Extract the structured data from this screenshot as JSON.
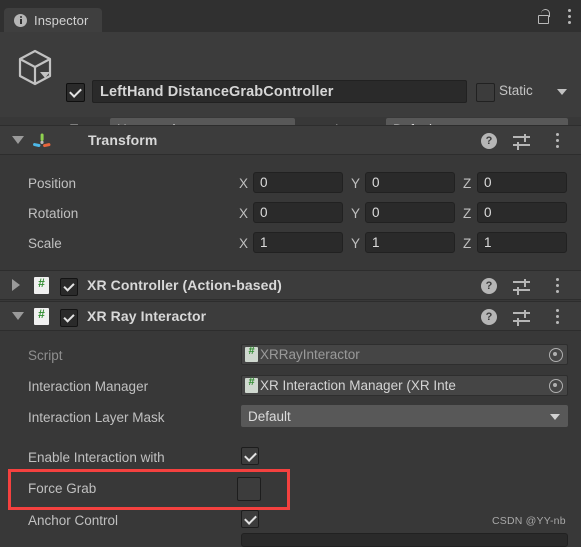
{
  "window": {
    "tab_label": "Inspector",
    "tab_icon": "info-icon",
    "lock_icon": "unlocked-padlock-icon",
    "menu_icon": "kebab-menu-icon"
  },
  "object_header": {
    "icon": "cube-gameobject-icon",
    "enabled": true,
    "name_value": "LeftHand DistanceGrabController",
    "static_label": "Static",
    "static_checked": false,
    "tag_label": "Tag",
    "tag_value": "Untagged",
    "layer_label": "Layer",
    "layer_value": "Default"
  },
  "components": [
    {
      "id": "transform",
      "title": "Transform",
      "icon": "transform-gizmo-icon",
      "expanded": true,
      "has_enable_checkbox": false,
      "rows": [
        {
          "label": "Position",
          "x": "0",
          "y": "0",
          "z": "0"
        },
        {
          "label": "Rotation",
          "x": "0",
          "y": "0",
          "z": "0"
        },
        {
          "label": "Scale",
          "x": "1",
          "y": "1",
          "z": "1"
        }
      ],
      "axis_labels": [
        "X",
        "Y",
        "Z"
      ]
    },
    {
      "id": "xr-controller",
      "title": "XR Controller (Action-based)",
      "icon": "csharp-script-icon",
      "expanded": false,
      "has_enable_checkbox": true,
      "enabled": true
    },
    {
      "id": "xr-ray-interactor",
      "title": "XR Ray Interactor",
      "icon": "csharp-script-icon",
      "expanded": true,
      "has_enable_checkbox": true,
      "enabled": true
    }
  ],
  "xr_ray_interactor_fields": {
    "script": {
      "label": "Script",
      "value": "XRRayInteractor",
      "icon": "csharp-script-icon",
      "readonly": true
    },
    "interaction_manager": {
      "label": "Interaction Manager",
      "value": "XR Interaction Manager (XR Inte",
      "icon": "csharp-script-icon"
    },
    "interaction_layer_mask": {
      "label": "Interaction Layer Mask",
      "value": "Default"
    },
    "enable_interaction": {
      "label": "Enable Interaction with",
      "checked": true
    },
    "force_grab": {
      "label": "Force Grab",
      "checked": false,
      "highlighted": true
    },
    "anchor_control": {
      "label": "Anchor Control",
      "checked": true
    }
  },
  "highlight": {
    "color": "#f4413f"
  },
  "watermark": {
    "text": "CSDN @YY-nb"
  },
  "colors": {
    "panel_bg": "#383838",
    "header_bg": "#3c3c3c",
    "tab_bg": "#3f3f3f",
    "strip_bg": "#303030",
    "field_bg": "#2a2a2a",
    "dropdown_bg": "#585858",
    "object_field_bg": "#454545",
    "text": "#c4c4c4",
    "accent_red": "#f4413f",
    "script_green": "#2e8b2e"
  }
}
